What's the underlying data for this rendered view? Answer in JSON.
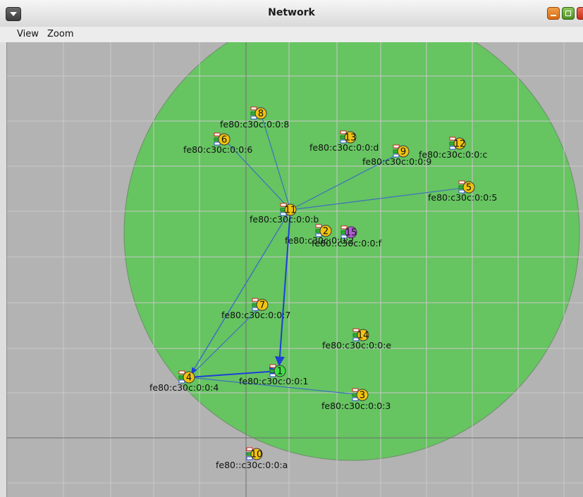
{
  "window": {
    "title": "Network"
  },
  "menu": {
    "view": "View",
    "zoom": "Zoom"
  },
  "colors": {
    "range": "#66c461",
    "link": "#3f6fc0",
    "grid": "#c8c8c8",
    "node_yellow": "#f2c30f",
    "node_green": "#3ee044",
    "node_purple": "#b05ed6"
  },
  "nodes": [
    {
      "id": "1",
      "label": "fe80:c30c:0:0:1",
      "badge": "1",
      "color": "green"
    },
    {
      "id": "2",
      "label": "fe80:c30c:0:0:2",
      "badge": "2",
      "color": "yellow"
    },
    {
      "id": "3",
      "label": "fe80:c30c:0:0:3",
      "badge": "3",
      "color": "yellow"
    },
    {
      "id": "4",
      "label": "fe80:c30c:0:0:4",
      "badge": "4",
      "color": "yellow"
    },
    {
      "id": "5",
      "label": "fe80:c30c:0:0:5",
      "badge": "5",
      "color": "yellow"
    },
    {
      "id": "6",
      "label": "fe80:c30c:0:0:6",
      "badge": "6",
      "color": "yellow"
    },
    {
      "id": "7",
      "label": "fe80:c30c:0:0:7",
      "badge": "7",
      "color": "yellow"
    },
    {
      "id": "8",
      "label": "fe80:c30c:0:0:8",
      "badge": "8",
      "color": "yellow"
    },
    {
      "id": "9",
      "label": "fe80:c30c:0:0:9",
      "badge": "9",
      "color": "yellow"
    },
    {
      "id": "10",
      "label": "fe80::c30c:0:0:a",
      "badge": "10",
      "color": "yellow"
    },
    {
      "id": "11",
      "label": "fe80:c30c:0:0:b",
      "badge": "11",
      "color": "yellow"
    },
    {
      "id": "12",
      "label": "fe80:c30c:0:0:c",
      "badge": "12",
      "color": "yellow"
    },
    {
      "id": "13",
      "label": "fe80:c30c:0:0:d",
      "badge": "13",
      "color": "yellow"
    },
    {
      "id": "14",
      "label": "fe80:c30c:0:0:e",
      "badge": "14",
      "color": "yellow"
    },
    {
      "id": "15",
      "label": "fe80::c30c:0:0:f",
      "badge": "15",
      "color": "purple"
    }
  ]
}
